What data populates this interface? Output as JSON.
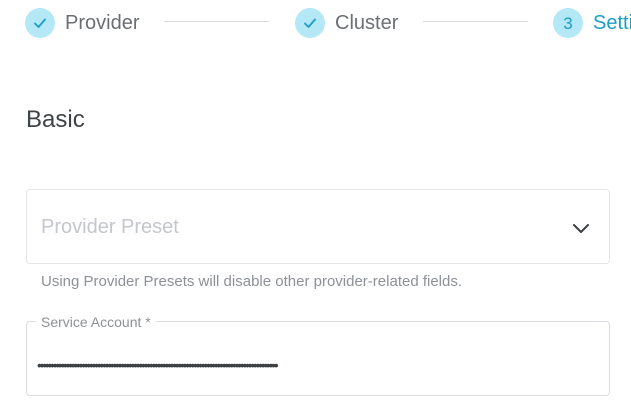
{
  "stepper": {
    "steps": [
      {
        "label": "Provider",
        "state": "completed",
        "icon": "check-icon"
      },
      {
        "label": "Cluster",
        "state": "completed",
        "icon": "check-icon"
      },
      {
        "label": "Setti",
        "state": "active",
        "number": "3"
      }
    ]
  },
  "basic": {
    "title": "Basic",
    "provider_preset": {
      "placeholder": "Provider Preset",
      "icon": "chevron-down-icon",
      "hint": "Using Provider Presets will disable other provider-related fields."
    },
    "service_account": {
      "label": "Service Account *",
      "value": "••••••••••••••••••••••••••••••••••••••••••••••••••••••••••••••••••••••••••••••••••••••••••••"
    }
  },
  "colors": {
    "accent": "#1a9ec5",
    "step_circle_bg": "#b5e8f6",
    "muted_text": "#8d9196",
    "border": "#e3e5e8"
  }
}
